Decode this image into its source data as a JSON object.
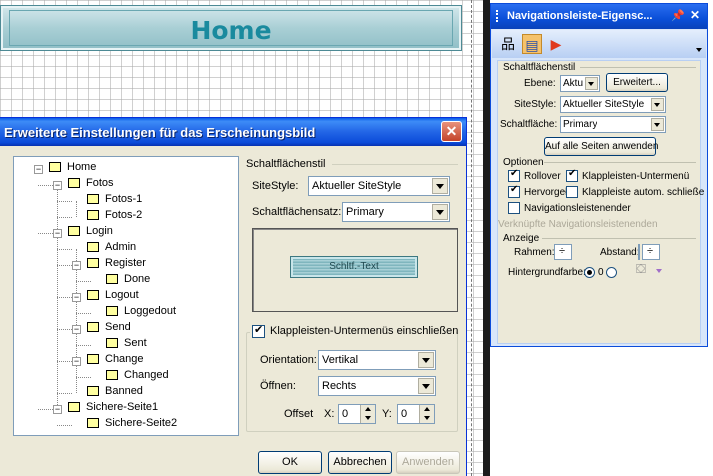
{
  "page": {
    "banner_title": "Home"
  },
  "dialog": {
    "title": "Erweiterte Einstellungen für das Erscheinungsbild",
    "close_glyph": "✕",
    "tree": [
      {
        "label": "Home",
        "level": 0
      },
      {
        "label": "Fotos",
        "level": 1
      },
      {
        "label": "Fotos-1",
        "level": 2
      },
      {
        "label": "Fotos-2",
        "level": 2
      },
      {
        "label": "Login",
        "level": 1
      },
      {
        "label": "Admin",
        "level": 2
      },
      {
        "label": "Register",
        "level": 2
      },
      {
        "label": "Done",
        "level": 3
      },
      {
        "label": "Logout",
        "level": 2
      },
      {
        "label": "Loggedout",
        "level": 3
      },
      {
        "label": "Send",
        "level": 2
      },
      {
        "label": "Sent",
        "level": 3
      },
      {
        "label": "Change",
        "level": 2
      },
      {
        "label": "Changed",
        "level": 3
      },
      {
        "label": "Banned",
        "level": 2
      },
      {
        "label": "Sichere-Seite1",
        "level": 1
      },
      {
        "label": "Sichere-Seite2",
        "level": 2
      }
    ],
    "button_style": {
      "group_label": "Schaltflächenstil",
      "sitestyle_label": "SiteStyle:",
      "sitestyle_value": "Aktueller SiteStyle",
      "buttonset_label": "Schaltflächensatz:",
      "buttonset_value": "Primary",
      "preview_text": "Schltf.-Text"
    },
    "dropdowns": {
      "checkbox_label": "Klappleisten-Untermenüs einschließen",
      "checked": true,
      "orientation_label": "Orientation:",
      "orientation_value": "Vertikal",
      "open_label": "Öffnen:",
      "open_value": "Rechts",
      "offset_label": "Offset",
      "x_label": "X:",
      "x_value": "0",
      "y_label": "Y:",
      "y_value": "0"
    },
    "buttons": {
      "ok": "OK",
      "cancel": "Abbrechen",
      "apply": "Anwenden"
    }
  },
  "panel": {
    "title": "Navigationsleiste-Eigensc...",
    "pin_glyph": "📌",
    "close_glyph": "✕",
    "toolbar": [
      {
        "icon": "sitemap-icon",
        "glyph": "品"
      },
      {
        "icon": "navbar-icon",
        "glyph": "▤"
      },
      {
        "icon": "play-icon",
        "glyph": "▶"
      }
    ],
    "button_style_group": "Schaltflächenstil",
    "level_label": "Ebene:",
    "level_value": "Aktu",
    "more_button": "Erweitert...",
    "sitestyle_label": "SiteStyle:",
    "sitestyle_value": "Aktueller SiteStyle",
    "button_label": "Schaltfläche:",
    "button_value": "Primary",
    "apply_all": "Auf alle Seiten anwenden",
    "options_group": "Optionen",
    "rollover": "Rollover",
    "dropdown_submenu": "Klappleisten-Untermenü",
    "highlight": "Hervorgeł",
    "autoclose": "Klappleiste autom. schließe",
    "nav_ends": "Navigationsleistenender",
    "linked_ends": "Verknüpfte Navigationsleistenenden",
    "display_group": "Anzeige",
    "frame_label": "Rahmen:",
    "spacing_label": "Abstand:",
    "background_label": "Hintergrundfarbe:",
    "bg_radio_zero": "0"
  }
}
